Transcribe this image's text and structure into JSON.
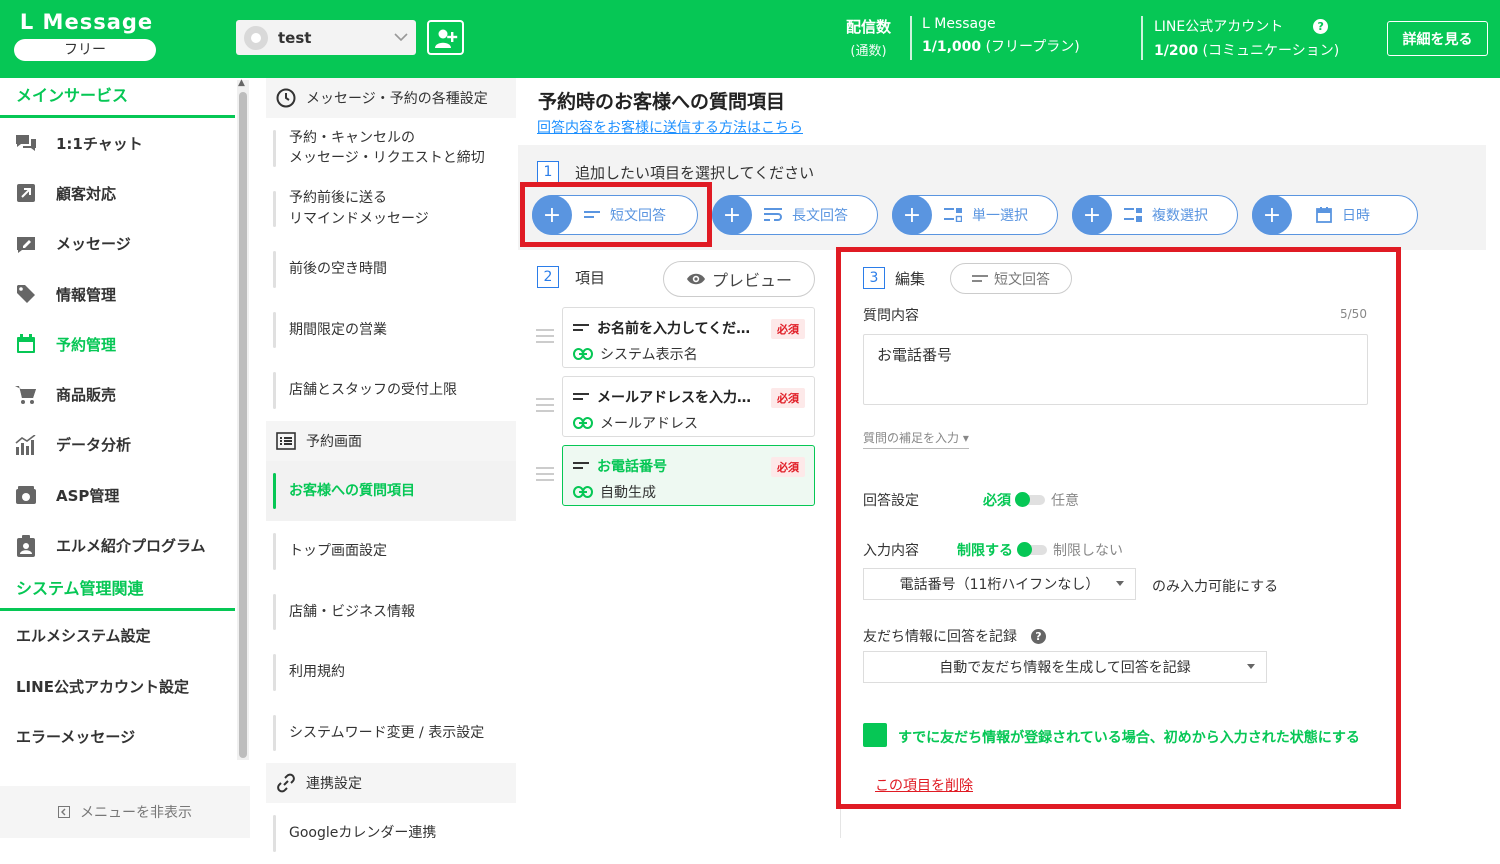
{
  "header": {
    "brand": "L Message",
    "plan": "フリー",
    "account_name": "test",
    "delivery_label": "配信数",
    "delivery_sub": "(通数)",
    "lmessage_label": "L Message",
    "lmessage_count": "1/1,000",
    "lmessage_plan": "(フリープラン)",
    "line_label": "LINE公式アカウント",
    "line_count": "1/200",
    "line_plan": "(コミュニケーション)",
    "help": "?",
    "detail_button": "詳細を見る"
  },
  "sidebar": {
    "section_main": "メインサービス",
    "items": [
      {
        "label": "1:1チャット",
        "icon": "chat-icon"
      },
      {
        "label": "顧客対応",
        "icon": "arrow-box-icon"
      },
      {
        "label": "メッセージ",
        "icon": "pencil-box-icon"
      },
      {
        "label": "情報管理",
        "icon": "tag-icon"
      },
      {
        "label": "予約管理",
        "icon": "calendar-icon"
      },
      {
        "label": "商品販売",
        "icon": "cart-icon"
      },
      {
        "label": "データ分析",
        "icon": "chart-icon"
      },
      {
        "label": "ASP管理",
        "icon": "wallet-icon"
      },
      {
        "label": "エルメ紹介プログラム",
        "icon": "clipboard-icon"
      }
    ],
    "section_system": "システム管理関連",
    "system_items": [
      "エルメシステム設定",
      "LINE公式アカウント設定",
      "エラーメッセージ"
    ],
    "hide_menu": "メニューを非表示"
  },
  "subnav": {
    "head1": "メッセージ・予約の各種設定",
    "items1": [
      "予約・キャンセルの\nメッセージ・リクエストと締切",
      "予約前後に送る\nリマインドメッセージ",
      "前後の空き時間",
      "期間限定の営業",
      "店舗とスタッフの受付上限"
    ],
    "head2": "予約画面",
    "items2": [
      "お客様への質問項目",
      "トップ画面設定",
      "店舗・ビジネス情報",
      "利用規約",
      "システムワード変更 / 表示設定"
    ],
    "head3": "連携設定",
    "items3": [
      "Googleカレンダー連携"
    ]
  },
  "main": {
    "title": "予約時のお客様への質問項目",
    "link": "回答内容をお客様に送信する方法はこちら",
    "step1_num": "1",
    "step1_label": "追加したい項目を選択してください",
    "add_buttons": [
      "短文回答",
      "長文回答",
      "単一選択",
      "複数選択",
      "日時"
    ],
    "step2_num": "2",
    "step2_label": "項目",
    "preview": "プレビュー",
    "questions": [
      {
        "title": "お名前を入力してくだ…",
        "sub": "システム表示名",
        "badge": "必須"
      },
      {
        "title": "メールアドレスを入力…",
        "sub": "メールアドレス",
        "badge": "必須"
      },
      {
        "title": "お電話番号",
        "sub": "自動生成",
        "badge": "必須"
      }
    ],
    "step3_num": "3",
    "step3_label": "編集",
    "type_chip": "短文回答",
    "question_label": "質問内容",
    "counter": "5/50",
    "question_value": "お電話番号",
    "supplement": "質問の補足を入力",
    "answer_setting": "回答設定",
    "required_on": "必須",
    "required_off": "任意",
    "input_label": "入力内容",
    "limit_on": "制限する",
    "limit_off": "制限しない",
    "input_select": "電話番号（11桁ハイフンなし）",
    "input_suffix": "のみ入力可能にする",
    "record_label": "友だち情報に回答を記録",
    "record_select": "自動で友だち情報を生成して回答を記録",
    "checkbox_label": "すでに友だち情報が登録されている場合、初めから入力された状態にする",
    "delete_link": "この項目を削除"
  },
  "colors": {
    "brand_green": "#06c755",
    "accent_blue": "#5a95e0",
    "highlight_red": "#e01b24"
  }
}
